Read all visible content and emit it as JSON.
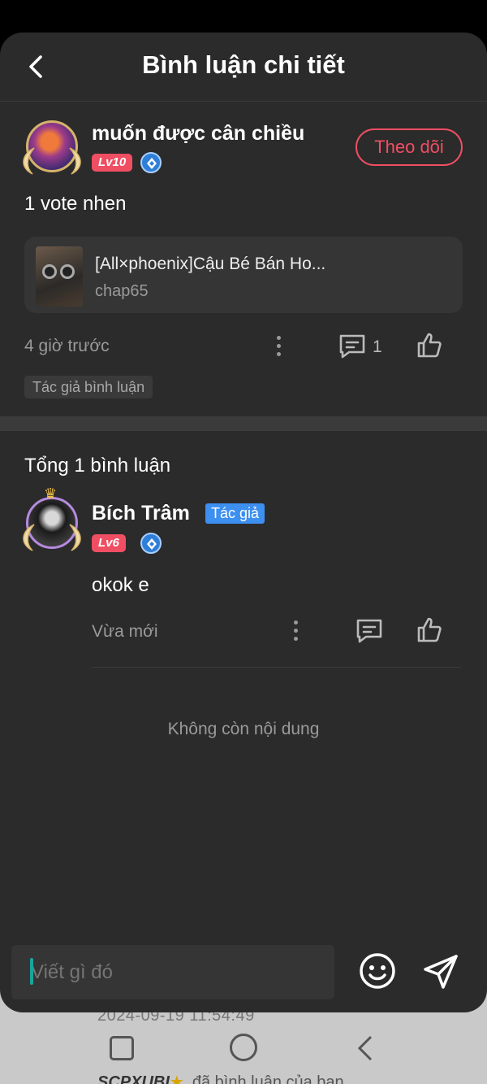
{
  "background_page": {
    "timestamp": "2024-09-19 11:54:49",
    "notify_name": "SCPXUBI",
    "notify_star": "★",
    "notify_text": "đã bình luận của bạn"
  },
  "header": {
    "title": "Bình luận chi tiết"
  },
  "comment": {
    "user_name": "muốn được cân chiều",
    "level": "Lv10",
    "follow_label": "Theo dõi",
    "text": "1 vote nhen",
    "book_title": "[All×phoenix]Cậu Bé Bán Ho...",
    "book_chapter": "chap65",
    "time": "4 giờ trước",
    "reply_count": "1",
    "author_tag": "Tác giả bình luận"
  },
  "replies": {
    "total_label": "Tổng 1 bình luận",
    "items": [
      {
        "user_name": "Bích Trâm",
        "author_badge": "Tác giả",
        "level": "Lv6",
        "text": "okok e",
        "time": "Vừa mới"
      }
    ],
    "end_label": "Không còn nội dung"
  },
  "composer": {
    "placeholder": "Viết gì đó"
  },
  "colors": {
    "accent": "#f04e63",
    "author_badge": "#3d8ff0",
    "sheet_bg": "#2b2b2b"
  }
}
